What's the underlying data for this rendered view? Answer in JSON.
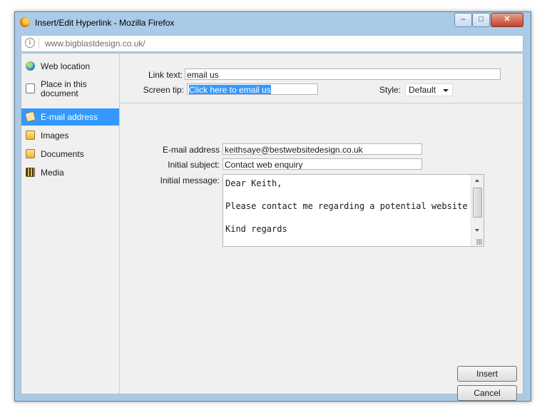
{
  "window": {
    "title": "Insert/Edit Hyperlink - Mozilla Firefox",
    "url": "www.bigblastdesign.co.uk/"
  },
  "window_controls": {
    "minimize": "–",
    "maximize": "□",
    "close": "✕"
  },
  "sidebar": {
    "items": [
      {
        "label": "Web location",
        "icon": "globe-icon"
      },
      {
        "label": "Place in this document",
        "icon": "document-icon"
      },
      {
        "label": "E-mail address",
        "icon": "email-icon",
        "active": true
      },
      {
        "label": "Images",
        "icon": "images-folder-icon"
      },
      {
        "label": "Documents",
        "icon": "documents-folder-icon"
      },
      {
        "label": "Media",
        "icon": "media-icon"
      }
    ]
  },
  "link": {
    "text_label": "Link text:",
    "text_value": "email us",
    "tip_label": "Screen tip:",
    "tip_value": "Click here to email us",
    "style_label": "Style:",
    "style_value": "Default"
  },
  "email": {
    "address_label": "E-mail address",
    "address_value": "keithsaye@bestwebsitedesign.co.uk",
    "subject_label": "Initial subject:",
    "subject_value": "Contact web enquiry",
    "message_label": "Initial message:",
    "message_value": "Dear Keith,\n\nPlease contact me regarding a potential website\n\nKind regards"
  },
  "buttons": {
    "insert": "Insert",
    "cancel": "Cancel"
  },
  "colors": {
    "accent": "#3399ff",
    "panel": "#f0f0f0",
    "frame": "#a9cbe8"
  }
}
